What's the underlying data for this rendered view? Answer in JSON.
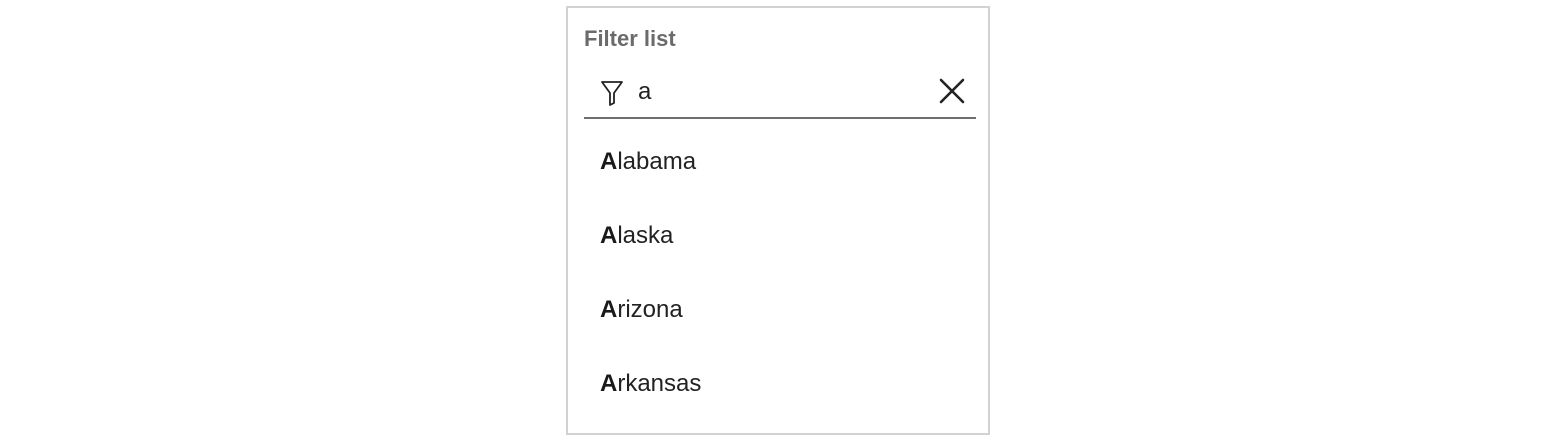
{
  "filter": {
    "label": "Filter list",
    "value": "a",
    "filter_icon": "filter-funnel-icon",
    "clear_icon": "close-icon"
  },
  "options": [
    {
      "match": "A",
      "rest": "labama"
    },
    {
      "match": "A",
      "rest": "laska"
    },
    {
      "match": "A",
      "rest": "rizona"
    },
    {
      "match": "A",
      "rest": "rkansas"
    }
  ]
}
